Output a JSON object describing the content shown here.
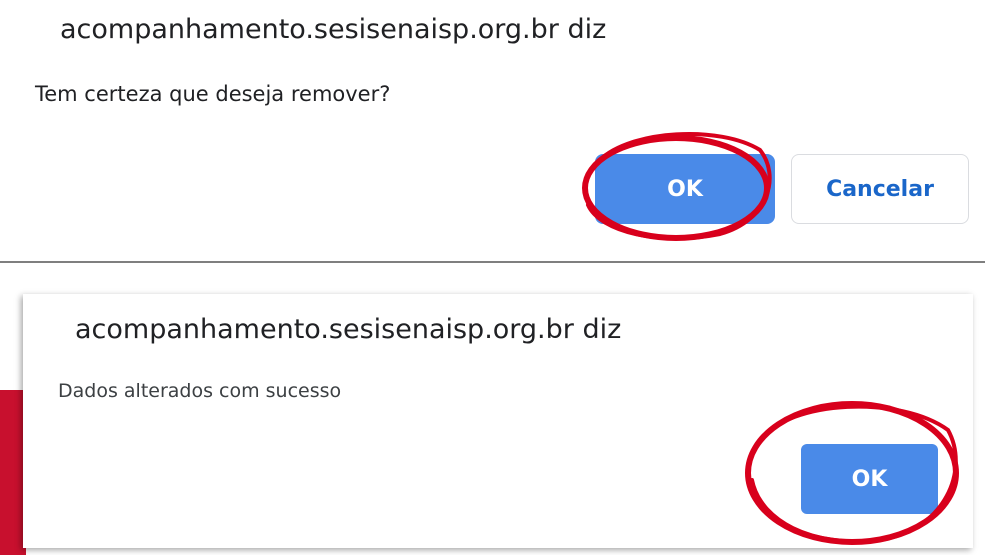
{
  "dialog_confirm": {
    "origin_text": "acompanhamento.sesisenaisp.org.br diz",
    "message": "Tem certeza que deseja remover?",
    "ok_label": "OK",
    "cancel_label": "Cancelar"
  },
  "dialog_alert": {
    "origin_text": "acompanhamento.sesisenaisp.org.br diz",
    "message": "Dados alterados com sucesso",
    "ok_label": "OK"
  },
  "colors": {
    "primary_button": "#4a8ae8",
    "cancel_text": "#1a66c9",
    "annotation_red": "#d8001c"
  }
}
